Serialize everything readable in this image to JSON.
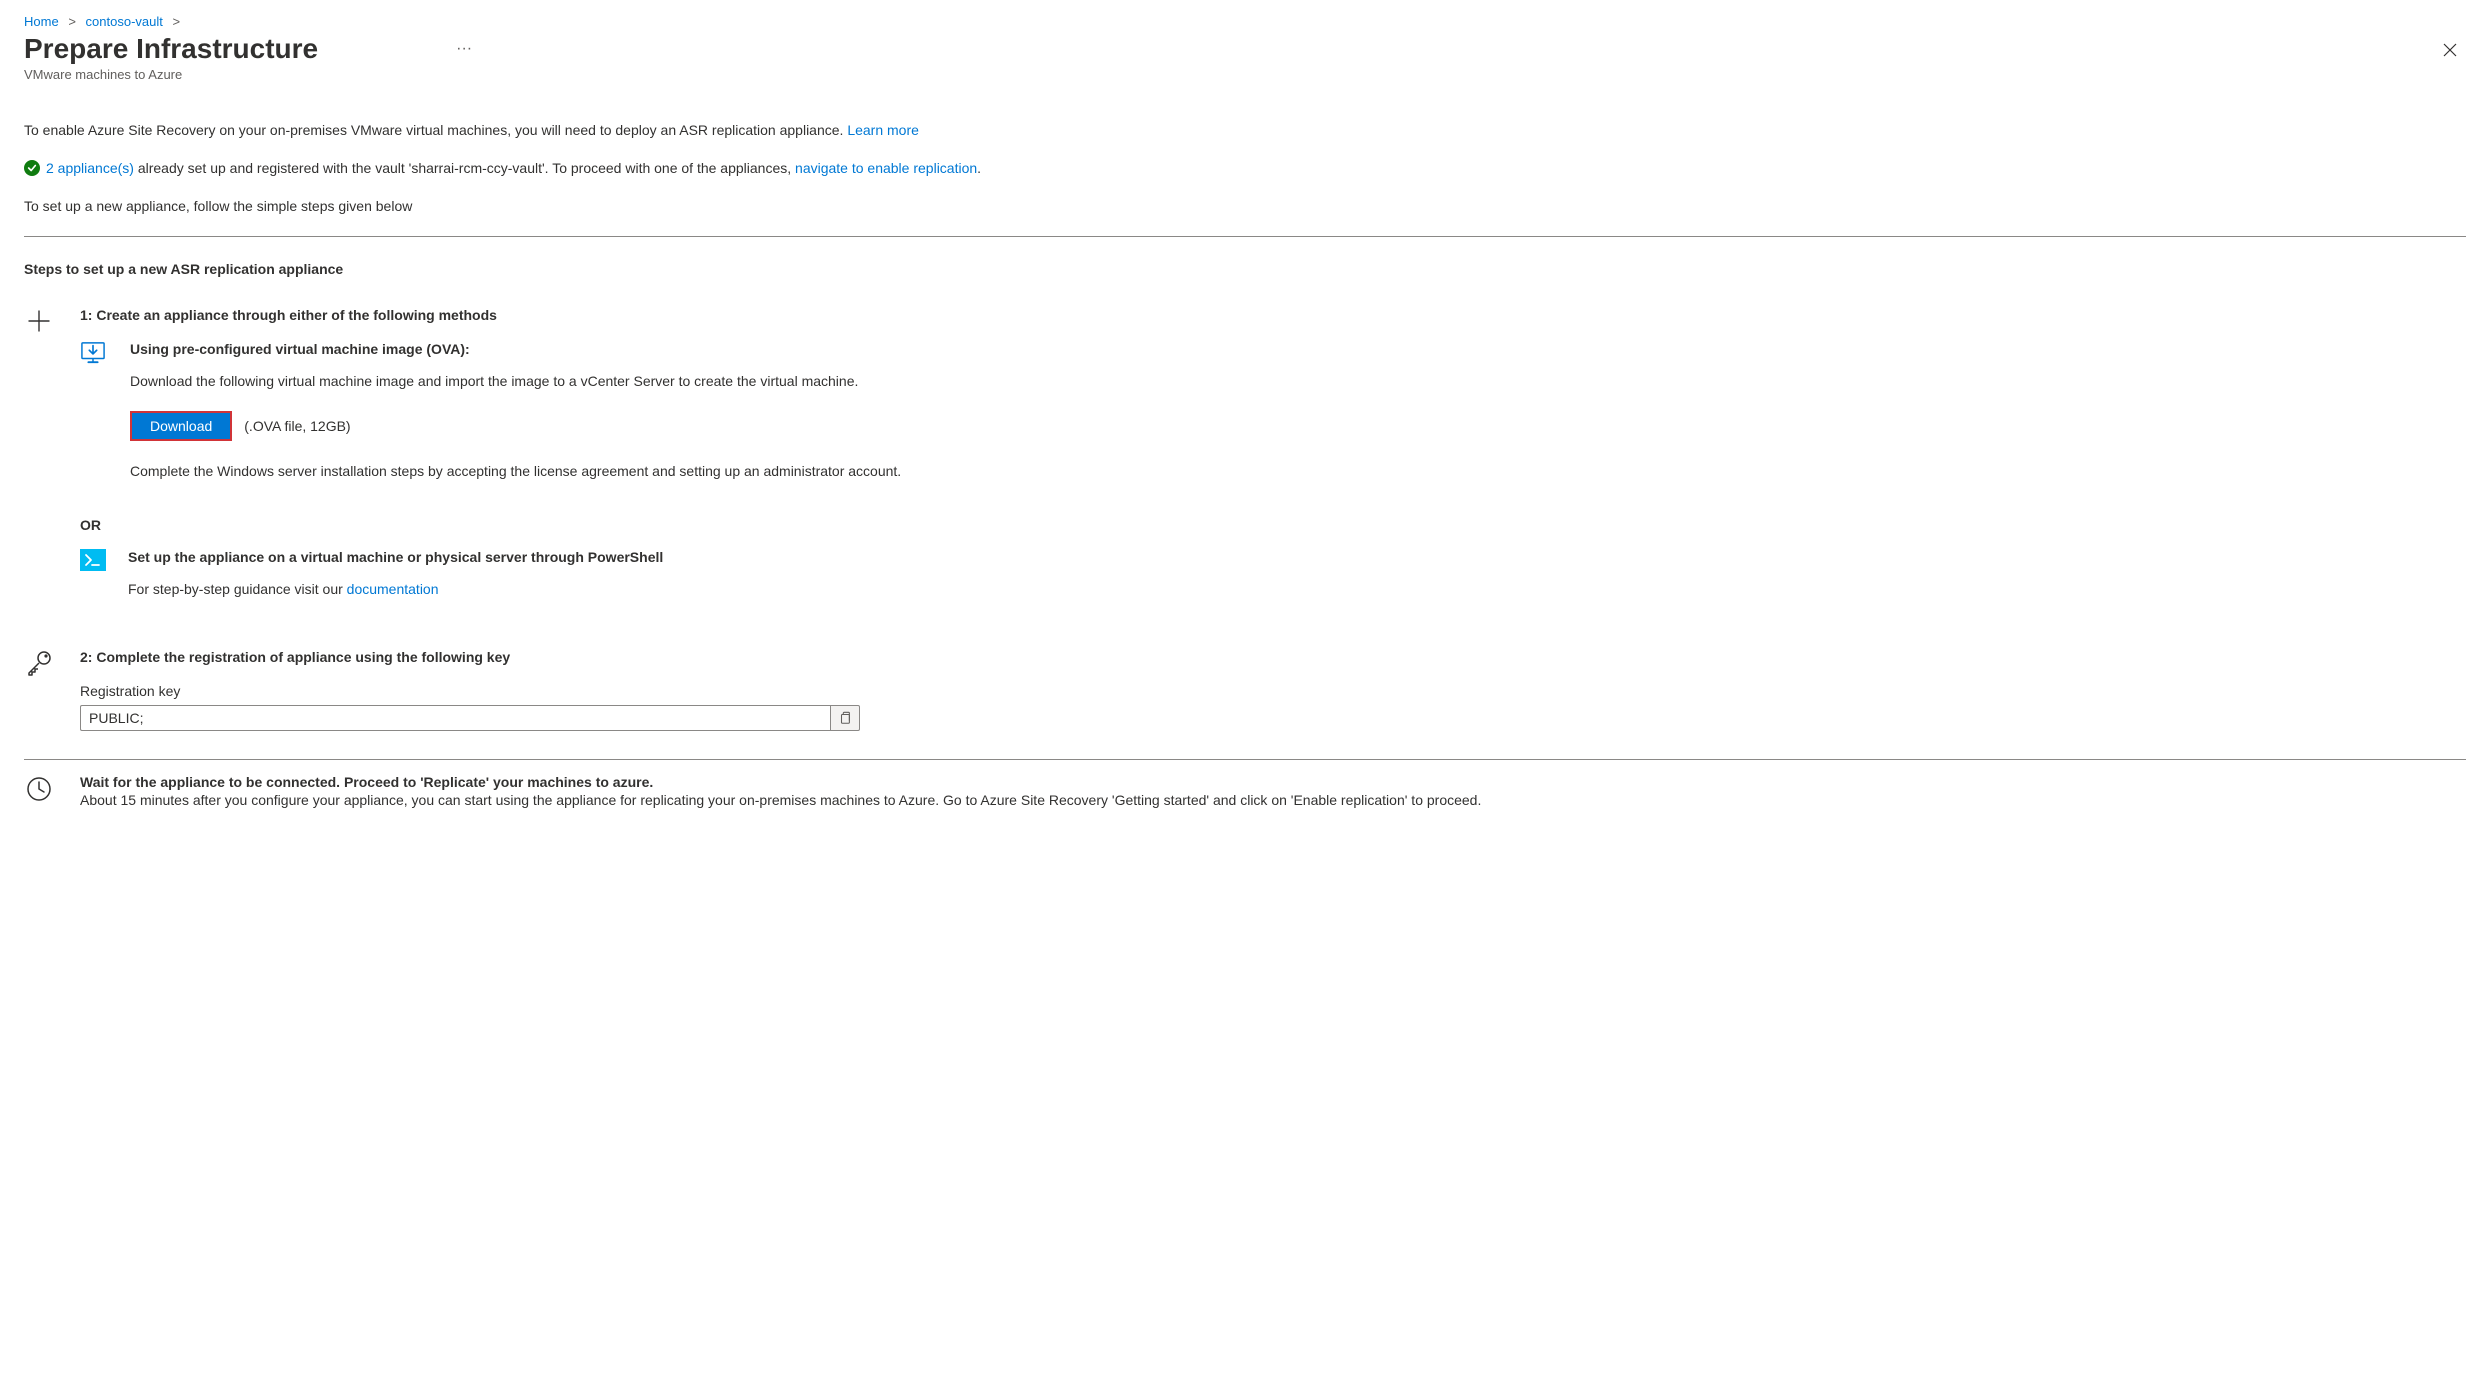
{
  "breadcrumb": {
    "home": "Home",
    "vault": "contoso-vault"
  },
  "header": {
    "title": "Prepare Infrastructure",
    "subtitle": "VMware machines to Azure"
  },
  "intro": {
    "text_prefix": "To enable Azure Site Recovery on your on-premises VMware virtual machines, you will need to deploy an ASR replication appliance. ",
    "learn_more": "Learn more"
  },
  "status": {
    "link_appliances": "2 appliance(s)",
    "mid_text": " already set up and registered with the vault 'sharrai-rcm-ccy-vault'. To proceed with one of the appliances, ",
    "link_navigate": "navigate to enable replication",
    "period": "."
  },
  "setup_note": "To set up a new appliance, follow the simple steps given below",
  "section_heading": "Steps to set up a new ASR replication appliance",
  "step1": {
    "title": "1: Create an appliance through either of the following methods",
    "method_a_heading": "Using pre-configured virtual machine image (OVA):",
    "method_a_text": "Download the following virtual machine image and import the image to a vCenter Server to create the virtual machine.",
    "download_label": "Download",
    "file_meta": "(.OVA file, 12GB)",
    "complete_text": "Complete the Windows server installation steps by accepting the license agreement and setting up an administrator account.",
    "or_label": "OR",
    "method_b_heading": "Set up the appliance on a virtual machine or physical server through PowerShell",
    "method_b_text_prefix": "For step-by-step guidance visit our ",
    "method_b_link": "documentation"
  },
  "step2": {
    "title": "2: Complete the registration of appliance using the following key",
    "reg_label": "Registration key",
    "reg_value": "PUBLIC;"
  },
  "wait": {
    "heading": "Wait for the appliance to be connected. Proceed to 'Replicate' your machines to azure.",
    "text": "About 15 minutes after you configure your appliance, you can start using the appliance for replicating your on-premises machines to Azure. Go to Azure Site Recovery 'Getting started' and click on 'Enable replication' to proceed."
  }
}
